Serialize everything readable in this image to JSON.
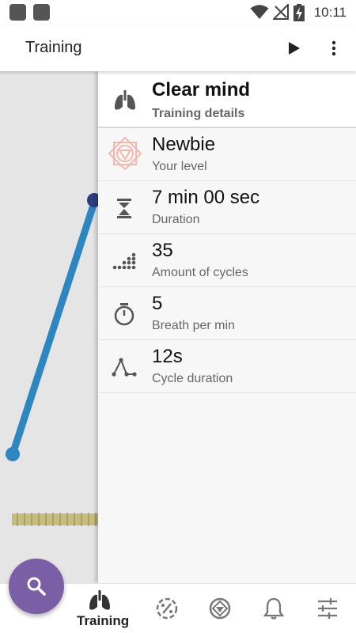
{
  "status_bar": {
    "time": "10:11"
  },
  "app_bar": {
    "title": "Training"
  },
  "details": {
    "title": "Clear mind",
    "subtitle": "Training details",
    "rows": [
      {
        "icon": "level-mandala-icon",
        "value": "Newbie",
        "label": "Your level"
      },
      {
        "icon": "hourglass-icon",
        "value": "7 min 00 sec",
        "label": "Duration"
      },
      {
        "icon": "dots-cycles-icon",
        "value": "35",
        "label": "Amount of cycles"
      },
      {
        "icon": "stopwatch-icon",
        "value": "5",
        "label": "Breath per min"
      },
      {
        "icon": "cycle-graph-icon",
        "value": "12s",
        "label": "Cycle duration"
      }
    ]
  },
  "bottom_nav": {
    "items": [
      {
        "icon": "lungs-icon",
        "label": "Training",
        "active": true
      },
      {
        "icon": "percent-badge-icon"
      },
      {
        "icon": "compass-icon"
      },
      {
        "icon": "bell-icon"
      },
      {
        "icon": "sliders-icon"
      }
    ]
  },
  "colors": {
    "line": "#2e86c1",
    "point_top": "#2c3e80",
    "ruler": "#c5bd7c",
    "fab": "#7b5fa6"
  }
}
